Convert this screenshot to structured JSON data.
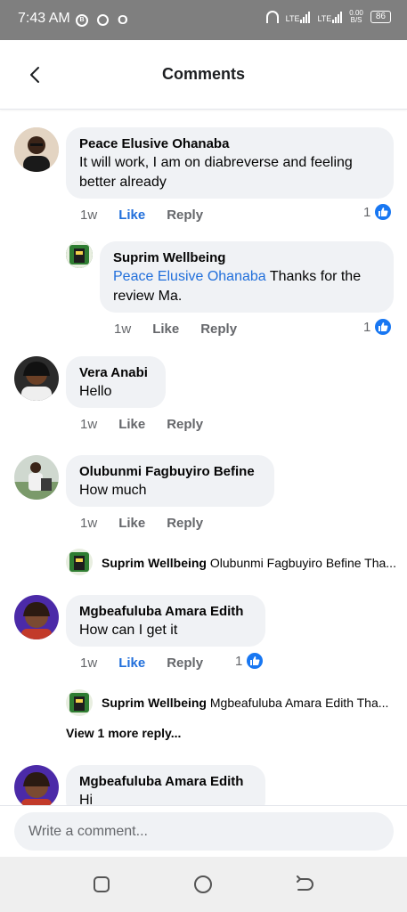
{
  "status_bar": {
    "time": "7:43 AM",
    "icons_left": [
      "b-icon",
      "circle-icon",
      "o-icon"
    ],
    "network_1": "LTE",
    "network_2": "LTE",
    "speed_value": "0.00",
    "speed_unit": "B/S",
    "battery": "86"
  },
  "header": {
    "title": "Comments"
  },
  "comments": [
    {
      "name": "Peace Elusive Ohanaba",
      "text_line1": "It will work, I am on diabreverse and feeling",
      "text_line2": "better already",
      "time": "1w",
      "like": "Like",
      "reply": "Reply",
      "reaction_count": "1",
      "liked": true
    },
    {
      "name": "Suprim Wellbeing",
      "mention": "Peace Elusive Ohanaba",
      "text_after_mention": " Thanks for the",
      "text_line2": "review Ma.",
      "time": "1w",
      "like": "Like",
      "reply": "Reply",
      "reaction_count": "1"
    },
    {
      "name": "Vera Anabi",
      "text": "Hello",
      "time": "1w",
      "like": "Like",
      "reply": "Reply"
    },
    {
      "name": "Olubunmi Fagbuyiro Befine",
      "text": "How much",
      "time": "1w",
      "like": "Like",
      "reply": "Reply",
      "collapsed_reply": {
        "name": "Suprim Wellbeing",
        "preview": "Olubunmi Fagbuyiro Befine Tha..."
      }
    },
    {
      "name": "Mgbeafuluba Amara Edith",
      "text": "How can I get it",
      "time": "1w",
      "like": "Like",
      "reply": "Reply",
      "reaction_count": "1",
      "liked": true,
      "collapsed_reply": {
        "name": "Suprim Wellbeing",
        "preview": "Mgbeafuluba Amara Edith Tha..."
      },
      "more_replies": "View 1 more reply..."
    },
    {
      "name": "Mgbeafuluba Amara Edith",
      "text": "Hi"
    }
  ],
  "composer": {
    "placeholder": "Write a comment..."
  },
  "colors": {
    "accent": "#216fdb",
    "bubble": "#f0f2f5",
    "status_bar": "#7f7f7f"
  }
}
